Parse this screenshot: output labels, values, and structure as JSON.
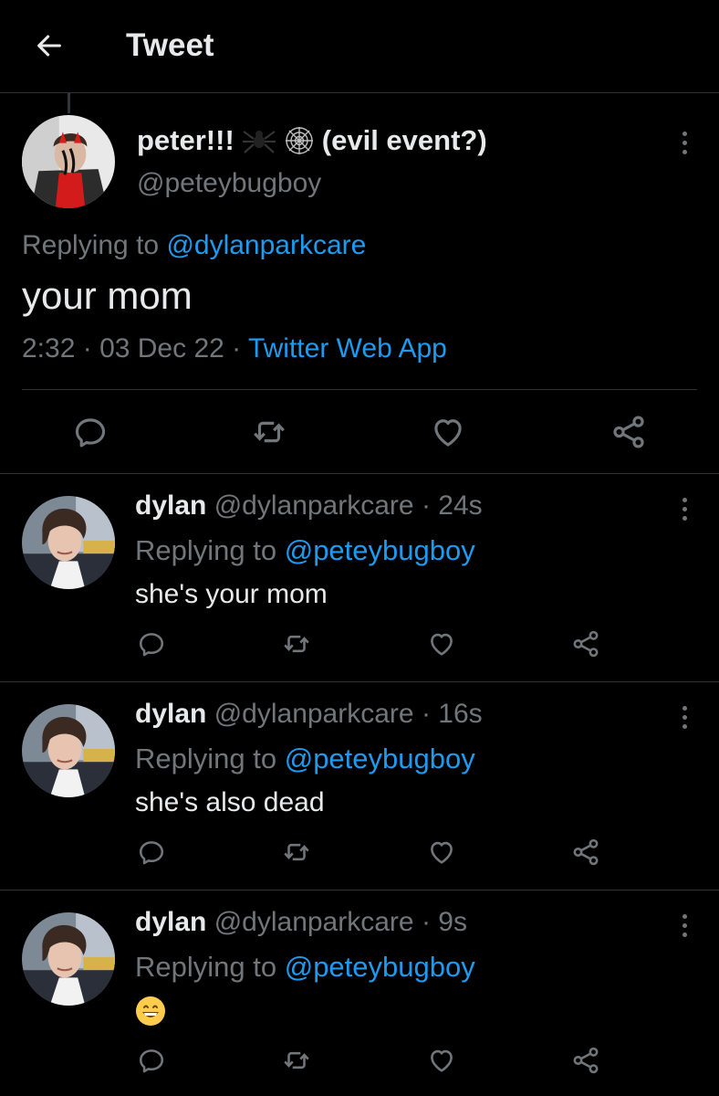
{
  "header": {
    "title": "Tweet"
  },
  "main_tweet": {
    "name": "peter!!!",
    "name_suffix": "(evil event?)",
    "handle": "@peteybugboy",
    "replying_label": "Replying to",
    "replying_to": "@dylanparkcare",
    "text": "your mom",
    "time": "2:32",
    "date": "03 Dec 22",
    "source": "Twitter Web App"
  },
  "replies": [
    {
      "name": "dylan",
      "handle": "@dylanparkcare",
      "time": "24s",
      "replying_label": "Replying to",
      "replying_to": "@peteybugboy",
      "text": "she's your mom"
    },
    {
      "name": "dylan",
      "handle": "@dylanparkcare",
      "time": "16s",
      "replying_label": "Replying to",
      "replying_to": "@peteybugboy",
      "text": "she's also dead"
    },
    {
      "name": "dylan",
      "handle": "@dylanparkcare",
      "time": "9s",
      "replying_label": "Replying to",
      "replying_to": "@peteybugboy",
      "text": ""
    }
  ],
  "icons": {
    "back": "arrow-left-icon",
    "reply": "comment-icon",
    "retweet": "retweet-icon",
    "like": "heart-icon",
    "share": "share-icon",
    "more": "more-vertical-icon"
  },
  "colors": {
    "background": "#000000",
    "text": "#e7e9ea",
    "secondary": "#71767b",
    "link": "#1d9bf0",
    "divider": "#2f3336"
  }
}
